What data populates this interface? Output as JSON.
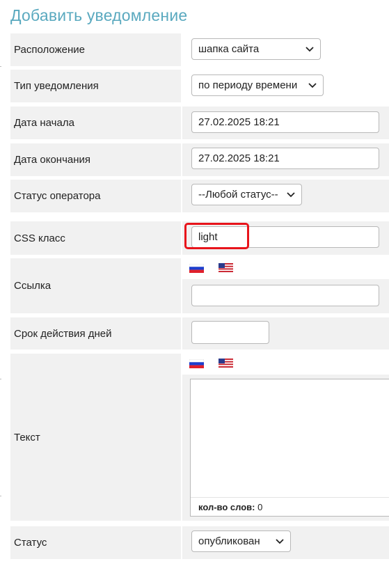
{
  "title": "Добавить уведомление",
  "fields": {
    "location": {
      "label": "Расположение",
      "value": "шапка сайта"
    },
    "notify_type": {
      "label": "Тип уведомления",
      "value": "по периоду времени"
    },
    "start_date": {
      "label": "Дата начала",
      "value": "27.02.2025 18:21"
    },
    "end_date": {
      "label": "Дата окончания",
      "value": "27.02.2025 18:21"
    },
    "operator_status": {
      "label": "Статус оператора",
      "value": "--Любой статус--"
    },
    "css_class": {
      "label": "CSS класс",
      "value": "light"
    },
    "link": {
      "label": "Ссылка",
      "value": ""
    },
    "validity_days": {
      "label": "Срок действия дней",
      "value": ""
    },
    "text": {
      "label": "Текст",
      "value": "",
      "word_count_label": "кол-во слов:",
      "word_count": "0"
    },
    "status": {
      "label": "Статус",
      "value": "опубликован"
    }
  },
  "languages": [
    "ru",
    "en"
  ],
  "colors": {
    "title": "#5aa9bf",
    "highlight": "#e8141b",
    "row_bg": "#f1f1f1"
  },
  "icons": {
    "flag_ru": "russian-flag-icon",
    "flag_en": "us-flag-icon",
    "chevron": "chevron-down-icon"
  }
}
